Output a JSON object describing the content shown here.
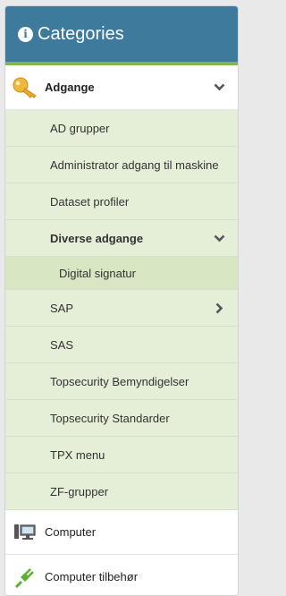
{
  "header": {
    "title": "Categories",
    "info_icon": "i"
  },
  "colors": {
    "header_bg": "#3d7a9c",
    "accent": "#83b64a",
    "sub_bg": "#e5efd8"
  },
  "items": [
    {
      "label": "Adgange",
      "icon": "key-icon",
      "expanded": true
    },
    {
      "label": "Computer",
      "icon": "computer-icon"
    },
    {
      "label": "Computer tilbehør",
      "icon": "plug-icon"
    }
  ],
  "sub_items": [
    {
      "label": "AD grupper"
    },
    {
      "label": "Administrator adgang til maskine"
    },
    {
      "label": "Dataset profiler"
    },
    {
      "label": "Diverse adgange",
      "expanded": true
    },
    {
      "label": "Digital signatur",
      "active": true
    },
    {
      "label": "SAP",
      "has_children": true
    },
    {
      "label": "SAS"
    },
    {
      "label": "Topsecurity Bemyndigelser"
    },
    {
      "label": "Topsecurity Standarder"
    },
    {
      "label": "TPX menu"
    },
    {
      "label": "ZF-grupper"
    }
  ]
}
